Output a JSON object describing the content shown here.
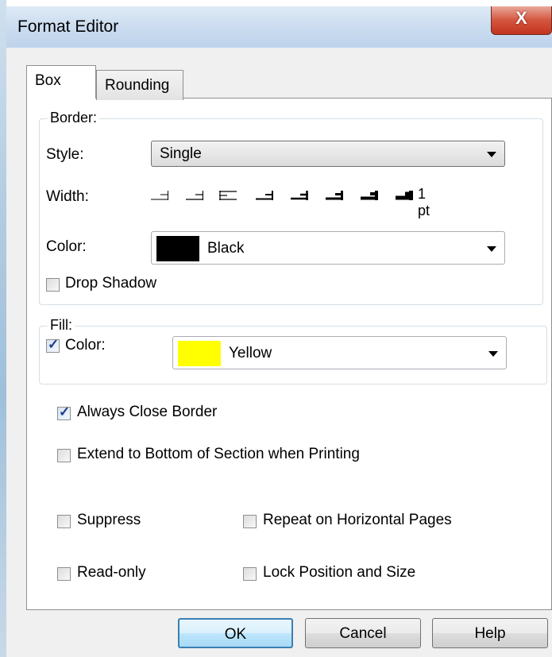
{
  "window": {
    "title": "Format Editor",
    "close_glyph": "X"
  },
  "tabs": [
    {
      "label": "Box",
      "active": true
    },
    {
      "label": "Rounding",
      "active": false
    }
  ],
  "border": {
    "group_label": "Border:",
    "style_label": "Style:",
    "style_value": "Single",
    "width_label": "Width:",
    "width_value": "1 pt",
    "color_label": "Color:",
    "color_value": "Black",
    "color_swatch": "#000000",
    "drop_shadow_label": "Drop Shadow",
    "drop_shadow_checked": false
  },
  "fill": {
    "group_label": "Fill:",
    "color_label": "Color:",
    "color_checked": true,
    "color_value": "Yellow",
    "color_swatch": "#ffff00"
  },
  "options": {
    "always_close_border": "Always Close Border",
    "extend_to_bottom": "Extend to Bottom of Section when Printing",
    "suppress": "Suppress",
    "repeat_horizontal": "Repeat on Horizontal Pages",
    "read_only": "Read-only",
    "lock_position": "Lock Position and Size"
  },
  "buttons": {
    "ok": "OK",
    "cancel": "Cancel",
    "help": "Help"
  }
}
